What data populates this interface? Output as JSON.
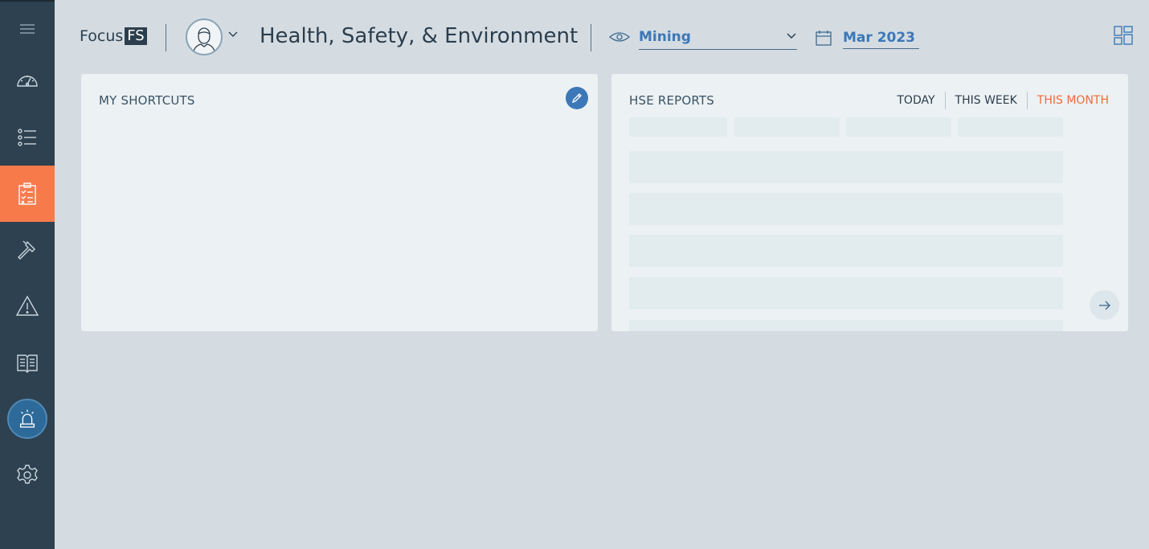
{
  "colors": {
    "sidebar_bg": "#2e4150",
    "active_accent": "#f77a4a",
    "link_blue": "#3c78b8",
    "page_bg": "#d4dce2",
    "card_bg": "#ecf1f3",
    "tab_active": "#ef6c3e"
  },
  "sidebar": {
    "items": [
      {
        "icon": "hamburger-menu-icon"
      },
      {
        "icon": "dashboard-gauge-icon"
      },
      {
        "icon": "list-icon"
      },
      {
        "icon": "clipboard-checklist-icon",
        "active": true
      },
      {
        "icon": "hammer-icon"
      },
      {
        "icon": "warning-triangle-icon"
      },
      {
        "icon": "book-icon"
      },
      {
        "icon": "siren-alarm-icon"
      },
      {
        "icon": "gear-icon"
      }
    ]
  },
  "header": {
    "logo_text": "Focus",
    "logo_badge": "FS",
    "title": "Health, Safety, & Environment",
    "site_select": {
      "value": "Mining"
    },
    "date_select": {
      "value": "Mar 2023"
    }
  },
  "shortcuts_card": {
    "title": "MY SHORTCUTS"
  },
  "reports_card": {
    "title": "HSE REPORTS",
    "tabs": [
      {
        "label": "TODAY",
        "active": false
      },
      {
        "label": "THIS WEEK",
        "active": false
      },
      {
        "label": "THIS MONTH",
        "active": true
      }
    ]
  }
}
